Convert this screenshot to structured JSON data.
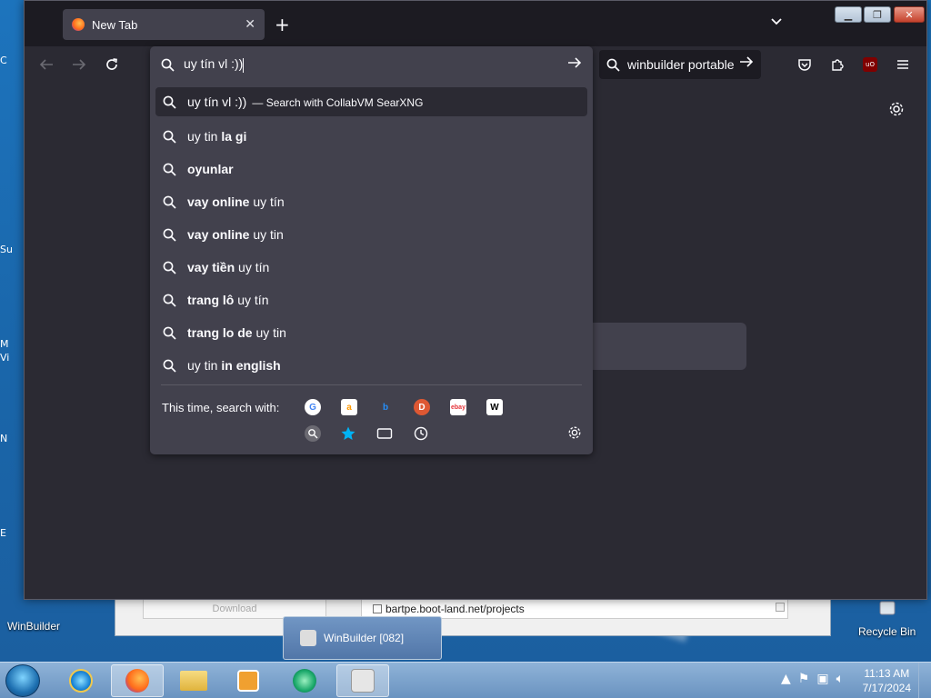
{
  "desktop": {
    "edge_labels": [
      "C",
      "Su",
      "M",
      "Vi",
      "N",
      "E"
    ],
    "winbuilder_label": "WinBuilder",
    "recycle_label": "Recycle Bin"
  },
  "bg_window": {
    "download_label": "Download",
    "project_url": "bartpe.boot-land.net/projects"
  },
  "taskbar": {
    "thumbnail_label": "WinBuilder [082]",
    "time": "11:13 AM",
    "date": "7/17/2024"
  },
  "browser": {
    "tab_title": "New Tab",
    "new_tab_symbol": "+",
    "url_value": "uy tín vl :))",
    "search_value": "winbuilder portable",
    "colors": {
      "frame": "#1c1b22",
      "toolbar": "#2b2a33",
      "panel": "#42414d",
      "text": "#fbfbfe"
    }
  },
  "suggestions": {
    "first": {
      "text": "uy tín vl :))",
      "hint": "— Search with CollabVM SearXNG"
    },
    "items": [
      {
        "pre": "uy tin ",
        "bold": "la gi",
        "post": ""
      },
      {
        "pre": "",
        "bold": "oyunlar",
        "post": ""
      },
      {
        "pre": "",
        "bold": "vay online",
        "post": " uy tín"
      },
      {
        "pre": "",
        "bold": "vay online",
        "post": " uy tin"
      },
      {
        "pre": "",
        "bold": "vay tiền",
        "post": " uy tín"
      },
      {
        "pre": "",
        "bold": "trang lô",
        "post": " uy tín"
      },
      {
        "pre": "",
        "bold": "trang lo de",
        "post": " uy tin"
      },
      {
        "pre": "uy tin ",
        "bold": "in english",
        "post": ""
      }
    ],
    "one_off_label": "This time, search with:",
    "engines": [
      {
        "icon": "google-icon",
        "glyph": "G",
        "color": "#4285f4"
      },
      {
        "icon": "amazon-icon",
        "glyph": "a",
        "color": "#ff9900"
      },
      {
        "icon": "bing-icon",
        "glyph": "b",
        "color": "#258ffa"
      },
      {
        "icon": "duckduckgo-icon",
        "glyph": "D",
        "color": "#de5833"
      },
      {
        "icon": "ebay-icon",
        "glyph": "ebay",
        "color": "#e53238"
      },
      {
        "icon": "wikipedia-icon",
        "glyph": "W",
        "color": "#000000"
      }
    ]
  }
}
